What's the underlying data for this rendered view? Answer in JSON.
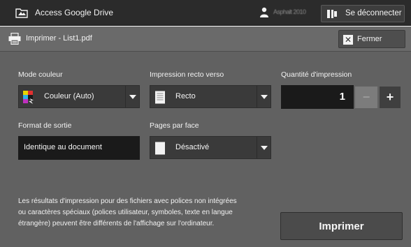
{
  "topbar": {
    "app_title": "Access Google Drive",
    "user_name": "Asphalt 2010",
    "logout_label": "Se déconnecter"
  },
  "header": {
    "doc_title": "Imprimer - List1.pdf",
    "close_label": "Fermer"
  },
  "color_mode": {
    "label": "Mode couleur",
    "value": "Couleur (Auto)"
  },
  "duplex": {
    "label": "Impression recto verso",
    "value": "Recto"
  },
  "quantity": {
    "label": "Quantité d'impression",
    "value": "1",
    "minus_label": "−",
    "plus_label": "+"
  },
  "output_format": {
    "label": "Format de sortie",
    "value": "Identique au document"
  },
  "pages_per_side": {
    "label": "Pages par face",
    "value": "Désactivé"
  },
  "notice": {
    "line1": "Les résultats d'impression pour des fichiers avec polices non intégrées",
    "line2": "ou caractères spéciaux (polices utilisateur, symboles, texte en langue",
    "line3": "étrangère) peuvent être différents de l'affichage sur l'ordinateur."
  },
  "print_button": {
    "label": "Imprimer"
  },
  "icons": {
    "app": "drive-folder-icon",
    "user": "user-icon",
    "logout": "logout-icon",
    "printer": "printer-icon",
    "close": "close-icon",
    "color_mode": "color-mode-icon",
    "duplex": "single-page-icon",
    "pages_per_side": "page-icon"
  },
  "colors": {
    "topbar": "#2b2b2b",
    "panel": "#616161",
    "dropdown": "#3a3a3a",
    "field_dark": "#1a1a1a"
  }
}
